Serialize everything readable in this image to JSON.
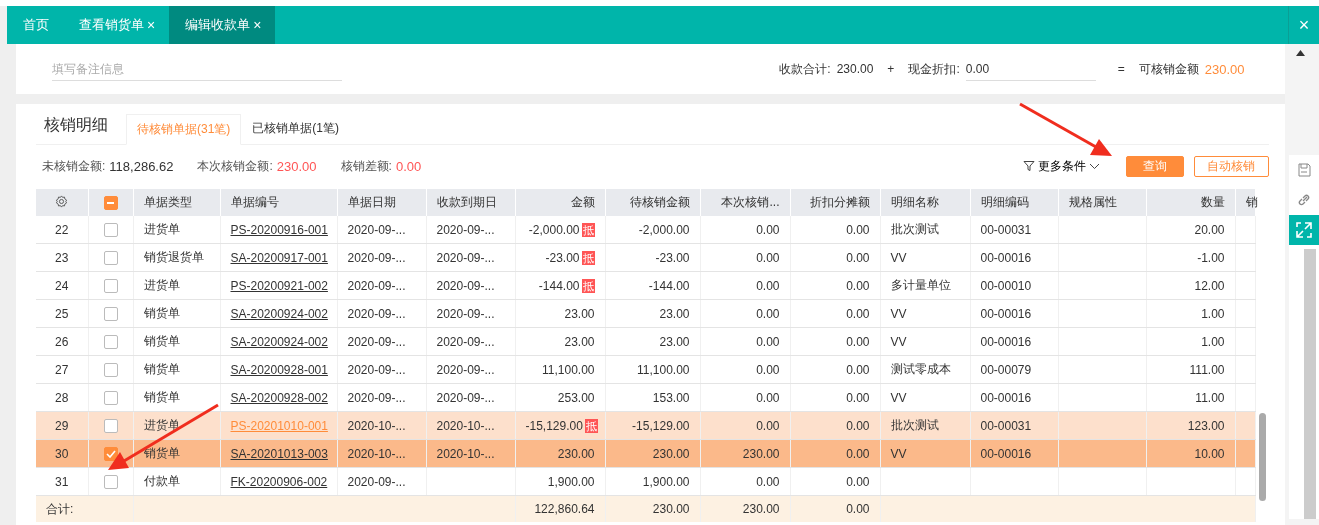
{
  "tabs": [
    {
      "label": "首页",
      "closable": false,
      "selected": false
    },
    {
      "label": "查看销货单",
      "closable": true,
      "selected": false
    },
    {
      "label": "编辑收款单",
      "closable": true,
      "selected": true
    }
  ],
  "close_glyph": "×",
  "remark": {
    "placeholder": "填写备注信息"
  },
  "summary": {
    "receipt_label": "收款合计:",
    "receipt_value": "230.00",
    "plus": "+",
    "discount_label": "现金折扣:",
    "discount_value": "0.00",
    "equals": "=",
    "available_label": "可核销金额",
    "available_value": "230.00"
  },
  "section": {
    "title": "核销明细",
    "tabs": [
      {
        "label": "待核销单据(31笔)",
        "selected": true
      },
      {
        "label": "已核销单据(1笔)",
        "selected": false
      }
    ]
  },
  "stats": [
    {
      "label": "未核销金额:",
      "value": "118,286.62",
      "highlight": false
    },
    {
      "label": "本次核销金额:",
      "value": "230.00",
      "highlight": true
    },
    {
      "label": "核销差额:",
      "value": "0.00",
      "highlight": true
    }
  ],
  "more_filters": "更多条件",
  "query_button": "查询",
  "auto_button": "自动核销",
  "table": {
    "select_all_partial": true,
    "columns": [
      "单据类型",
      "单据编号",
      "单据日期",
      "收款到期日",
      "金额",
      "待核销金额",
      "本次核销...",
      "折扣分摊额",
      "明细名称",
      "明细编码",
      "规格属性",
      "数量",
      "销"
    ],
    "rows": [
      {
        "no": "22",
        "checked": false,
        "hovered": false,
        "selected": false,
        "type": "进货单",
        "code": "PS-20200916-001",
        "date": "2020-09-...",
        "due": "2020-09-...",
        "amount": "-2,000.00",
        "badge": "抵",
        "pending": "-2,000.00",
        "this": "0.00",
        "discount": "0.00",
        "item": "批次测试",
        "item_code": "00-00031",
        "qty": "20.00"
      },
      {
        "no": "23",
        "checked": false,
        "hovered": false,
        "selected": false,
        "type": "销货退货单",
        "code": "SA-20200917-001",
        "date": "2020-09-...",
        "due": "2020-09-...",
        "amount": "-23.00",
        "badge": "抵",
        "pending": "-23.00",
        "this": "0.00",
        "discount": "0.00",
        "item": "VV",
        "item_code": "00-00016",
        "qty": "-1.00"
      },
      {
        "no": "24",
        "checked": false,
        "hovered": false,
        "selected": false,
        "type": "进货单",
        "code": "PS-20200921-002",
        "date": "2020-09-...",
        "due": "2020-09-...",
        "amount": "-144.00",
        "badge": "抵",
        "pending": "-144.00",
        "this": "0.00",
        "discount": "0.00",
        "item": "多计量单位",
        "item_code": "00-00010",
        "qty": "12.00"
      },
      {
        "no": "25",
        "checked": false,
        "hovered": false,
        "selected": false,
        "type": "销货单",
        "code": "SA-20200924-002",
        "date": "2020-09-...",
        "due": "2020-09-...",
        "amount": "23.00",
        "pending": "23.00",
        "this": "0.00",
        "discount": "0.00",
        "item": "VV",
        "item_code": "00-00016",
        "qty": "1.00"
      },
      {
        "no": "26",
        "checked": false,
        "hovered": false,
        "selected": false,
        "type": "销货单",
        "code": "SA-20200924-002",
        "date": "2020-09-...",
        "due": "2020-09-...",
        "amount": "23.00",
        "pending": "23.00",
        "this": "0.00",
        "discount": "0.00",
        "item": "VV",
        "item_code": "00-00016",
        "qty": "1.00"
      },
      {
        "no": "27",
        "checked": false,
        "hovered": false,
        "selected": false,
        "type": "销货单",
        "code": "SA-20200928-001",
        "date": "2020-09-...",
        "due": "2020-09-...",
        "amount": "11,100.00",
        "pending": "11,100.00",
        "this": "0.00",
        "discount": "0.00",
        "item": "测试零成本",
        "item_code": "00-00079",
        "qty": "111.00"
      },
      {
        "no": "28",
        "checked": false,
        "hovered": false,
        "selected": false,
        "type": "销货单",
        "code": "SA-20200928-002",
        "date": "2020-09-...",
        "due": "2020-09-...",
        "amount": "253.00",
        "pending": "153.00",
        "this": "0.00",
        "discount": "0.00",
        "item": "VV",
        "item_code": "00-00016",
        "qty": "11.00"
      },
      {
        "no": "29",
        "checked": false,
        "hovered": true,
        "selected": false,
        "type": "进货单",
        "code": "PS-20201010-001",
        "date": "2020-10-...",
        "due": "2020-10-...",
        "amount": "-15,129.00",
        "badge": "抵",
        "pending": "-15,129.00",
        "this": "0.00",
        "discount": "0.00",
        "item": "批次测试",
        "item_code": "00-00031",
        "qty": "123.00"
      },
      {
        "no": "30",
        "checked": true,
        "hovered": false,
        "selected": true,
        "type": "销货单",
        "code": "SA-20201013-003",
        "date": "2020-10-...",
        "due": "2020-10-...",
        "amount": "230.00",
        "pending": "230.00",
        "this": "230.00",
        "discount": "0.00",
        "item": "VV",
        "item_code": "00-00016",
        "qty": "10.00"
      },
      {
        "no": "31",
        "checked": false,
        "hovered": false,
        "selected": false,
        "type": "付款单",
        "code": "FK-20200906-002",
        "date": "2020-09-...",
        "amount": "1,900.00",
        "pending": "1,900.00",
        "this": "0.00",
        "discount": "0.00"
      }
    ],
    "total": {
      "label": "合计:",
      "amount": "122,860.64",
      "pending": "230.00",
      "this": "230.00",
      "discount": "0.00"
    }
  }
}
